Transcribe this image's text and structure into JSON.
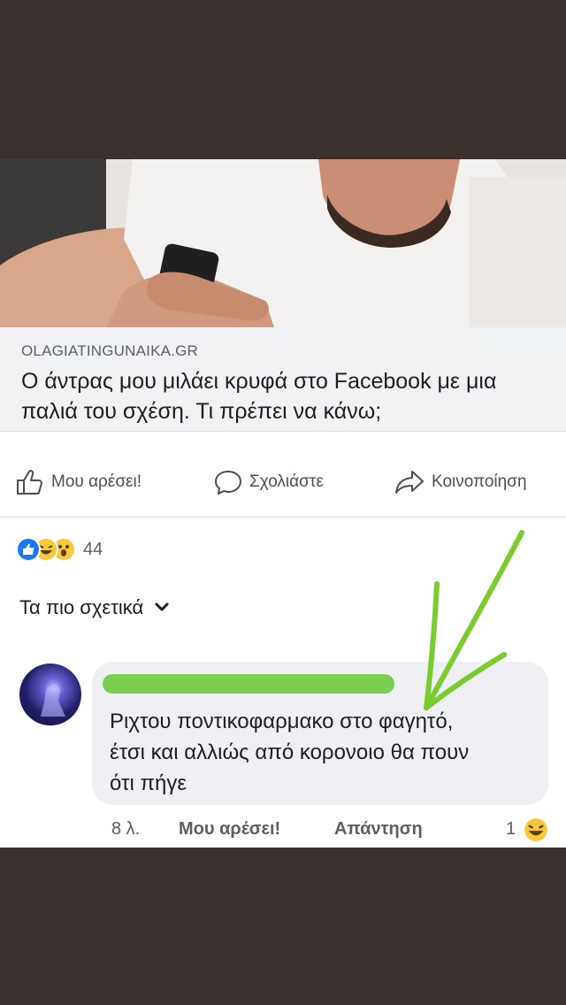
{
  "link_preview": {
    "domain": "OLAGIATINGUNAIKA.GR",
    "headline": "Ο άντρας μου μιλάει κρυφά στο Facebook με μια παλιά του σχέση. Τι πρέπει να κάνω;"
  },
  "actions": {
    "like_label": "Μου αρέσει!",
    "comment_label": "Σχολιάστε",
    "share_label": "Κοινοποίηση"
  },
  "reactions": {
    "icons": [
      "like-icon",
      "haha-icon",
      "wow-icon"
    ],
    "count": "44"
  },
  "comments_sort": {
    "label": "Τα πιο σχετικά"
  },
  "comment": {
    "text": "Ριχτου ποντικοφαρμακο στο φαγητό, έτσι και αλλιώς από κορονοιο θα πουν ότι πήγε",
    "time": "8 λ.",
    "like_label": "Μου αρέσει!",
    "reply_label": "Απάντηση",
    "reaction_count": "1",
    "reaction_icon": "haha-icon"
  },
  "colors": {
    "background": "#3a302e",
    "card": "#ffffff",
    "annotation_green": "#7acb2e",
    "like_blue": "#1877f2",
    "emoji_yellow": "#f7c83a"
  }
}
